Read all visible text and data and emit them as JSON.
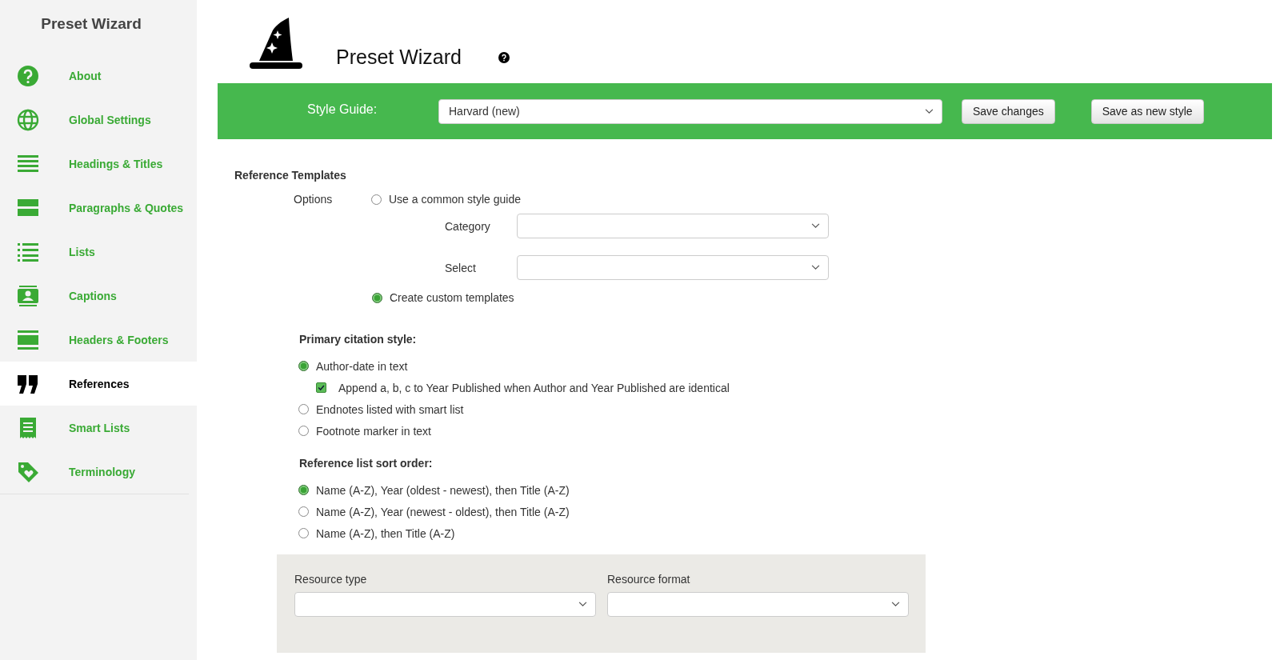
{
  "sidebar": {
    "title": "Preset Wizard",
    "items": [
      {
        "label": "About",
        "selected": false
      },
      {
        "label": "Global Settings",
        "selected": false
      },
      {
        "label": "Headings & Titles",
        "selected": false
      },
      {
        "label": "Paragraphs & Quotes",
        "selected": false
      },
      {
        "label": "Lists",
        "selected": false
      },
      {
        "label": "Captions",
        "selected": false
      },
      {
        "label": "Headers & Footers",
        "selected": false
      },
      {
        "label": "References",
        "selected": true
      },
      {
        "label": "Smart Lists",
        "selected": false
      },
      {
        "label": "Terminology",
        "selected": false
      }
    ]
  },
  "header": {
    "title": "Preset Wizard"
  },
  "toolbar": {
    "label": "Style Guide:",
    "style_guide": {
      "value": "Harvard (new)"
    },
    "buttons": [
      "Save changes",
      "Save as new style"
    ]
  },
  "reference_templates": {
    "heading": "Reference Templates",
    "options_label": "Options",
    "options": [
      {
        "label": "Use a common style guide",
        "selected": false
      },
      {
        "label": "Create custom templates",
        "selected": true
      }
    ],
    "category": {
      "label": "Category"
    },
    "select": {
      "label": "Select"
    }
  },
  "primary_citation": {
    "heading": "Primary citation style:",
    "options": [
      {
        "label": "Author-date in text",
        "selected": true
      },
      {
        "label": "Endnotes listed with smart list",
        "selected": false
      },
      {
        "label": "Footnote marker in text",
        "selected": false
      }
    ],
    "append_option": {
      "label": "Append a, b, c to Year Published when Author and Year Published are identical",
      "checked": true
    }
  },
  "sort_order": {
    "heading": "Reference list sort order:",
    "options": [
      {
        "label": "Name (A-Z), Year (oldest - newest), then Title (A-Z)",
        "selected": true
      },
      {
        "label": "Name (A-Z), Year (newest - oldest), then Title (A-Z)",
        "selected": false
      },
      {
        "label": "Name (A-Z), then Title (A-Z)",
        "selected": false
      }
    ]
  },
  "resource_panel": {
    "resource_type": {
      "label": "Resource type"
    },
    "resource_format": {
      "label": "Resource format"
    }
  }
}
